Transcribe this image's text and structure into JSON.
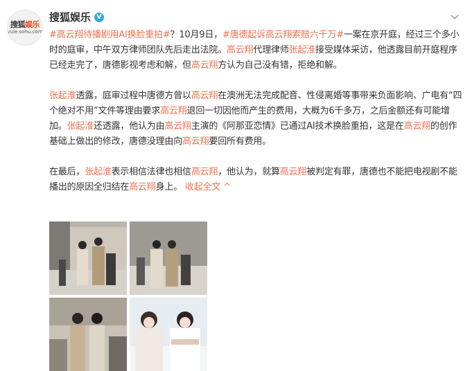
{
  "account": {
    "name": "搜狐娱乐",
    "verified_badge": "V",
    "avatar_logo_1": "搜狐",
    "avatar_logo_2": "娱乐",
    "avatar_url": "yule.sohu.com"
  },
  "post": {
    "p1": [
      {
        "t": "#高云翔待播剧用AI换脸重拍#",
        "c": "topic"
      },
      {
        "t": "？10月9日，",
        "c": ""
      },
      {
        "t": "#唐德起诉高云翔索赔六千万#",
        "c": "topic"
      },
      {
        "t": "一案在京开庭，经过三个多小时的庭审，中午双方律师团队先后走出法院。",
        "c": ""
      },
      {
        "t": "高云翔",
        "c": "kw"
      },
      {
        "t": "代理律师",
        "c": ""
      },
      {
        "t": "张起淮",
        "c": "kw"
      },
      {
        "t": "接受媒体采访，他透露目前开庭程序已经走完了，唐德影视考虑和解，但",
        "c": ""
      },
      {
        "t": "高云翔",
        "c": "kw"
      },
      {
        "t": "方认为自己没有错，拒绝和解。",
        "c": ""
      }
    ],
    "p2": [
      {
        "t": "张起淮",
        "c": "kw"
      },
      {
        "t": "透露，庭审过程中唐德方曾以",
        "c": ""
      },
      {
        "t": "高云翔",
        "c": "kw"
      },
      {
        "t": "在澳洲无法完成配音、性侵离婚等事带来负面影响、广电有“四个绝对不用”文件等理由要求",
        "c": ""
      },
      {
        "t": "高云翔",
        "c": "kw"
      },
      {
        "t": "退回一切因他而产生的费用，大概为6千多万，之后金额还有可能增加。",
        "c": ""
      },
      {
        "t": "张起淮",
        "c": "kw"
      },
      {
        "t": "还透露，他认为由",
        "c": ""
      },
      {
        "t": "高云翔",
        "c": "kw"
      },
      {
        "t": "主演的《阿那亚恋情》已通过AI技术换脸重拍，这是在",
        "c": ""
      },
      {
        "t": "高云翔",
        "c": "kw"
      },
      {
        "t": "的创作基础上做出的修改，唐德没理由向",
        "c": ""
      },
      {
        "t": "高云翔",
        "c": "kw"
      },
      {
        "t": "要回所有费用。",
        "c": ""
      }
    ],
    "p3": [
      {
        "t": "在最后，",
        "c": ""
      },
      {
        "t": "张起淮",
        "c": "kw"
      },
      {
        "t": "表示相信法律也相信",
        "c": ""
      },
      {
        "t": "高云翔",
        "c": "kw"
      },
      {
        "t": "，他认为，就算",
        "c": ""
      },
      {
        "t": "高云翔",
        "c": "kw"
      },
      {
        "t": "被判定有罪，唐德也不能把电视剧不能播出的原因全归结在",
        "c": ""
      },
      {
        "t": "高云翔",
        "c": "kw"
      },
      {
        "t": "身上。 ",
        "c": ""
      },
      {
        "t": "收起全文",
        "c": "collapse"
      }
    ],
    "collapse_arrow": "^"
  },
  "colors": {
    "link": "#eb7350",
    "verified": "#35a8e0",
    "text": "#333333"
  },
  "icons": {
    "more": "chevron-down-icon"
  }
}
